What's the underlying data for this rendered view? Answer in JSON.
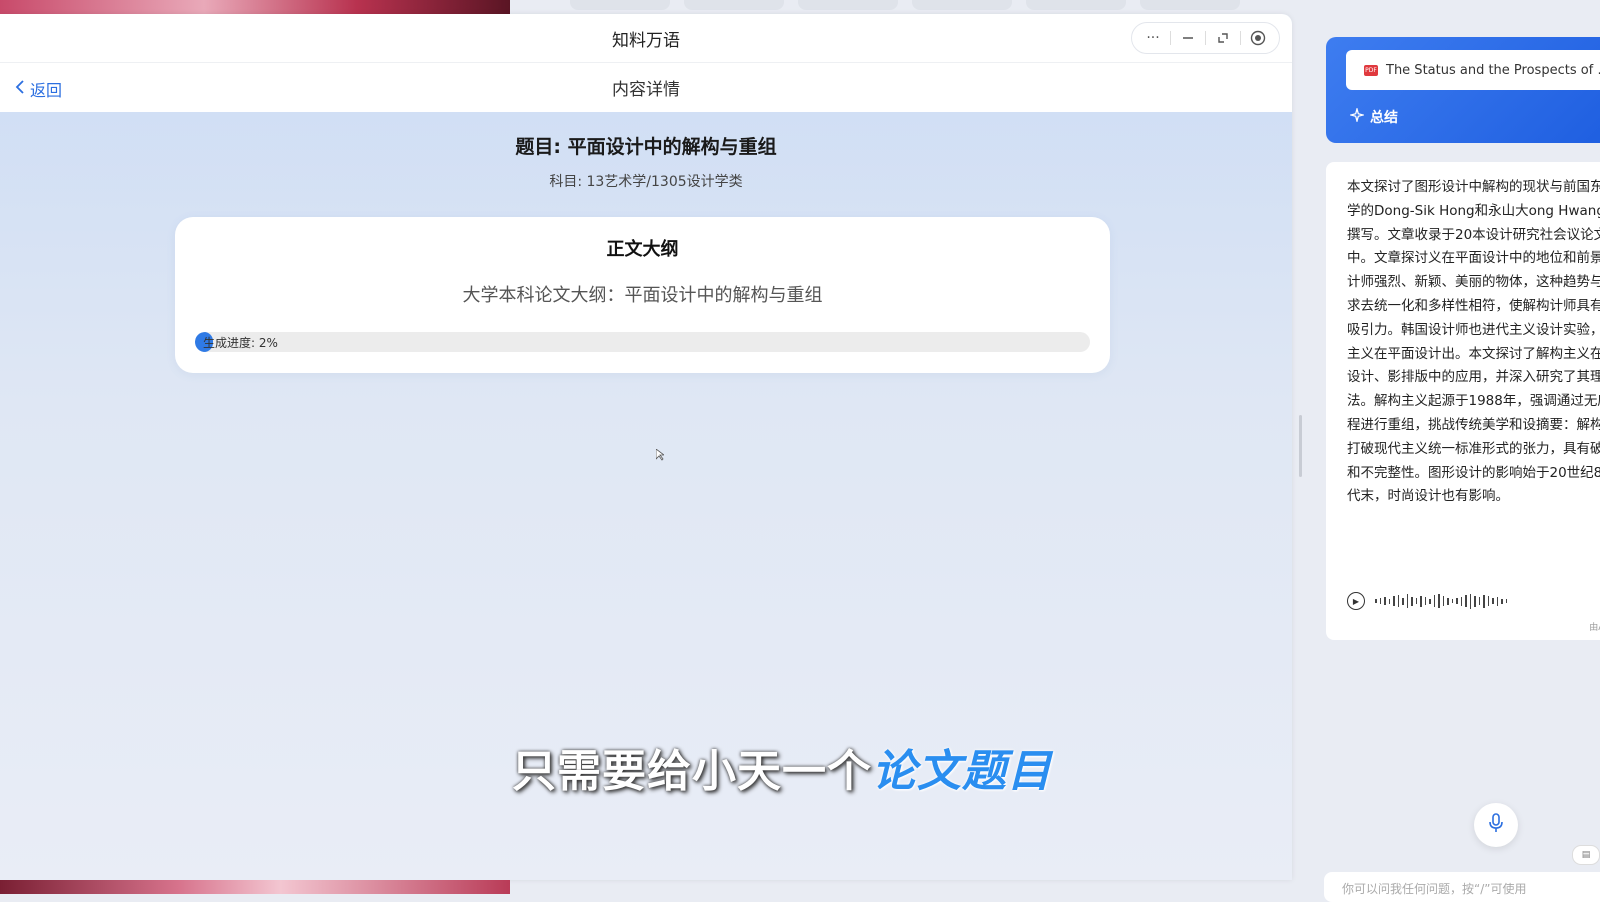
{
  "window": {
    "app_title": "知料万语",
    "nav": {
      "back_label": "返回",
      "page_title": "内容详情"
    }
  },
  "content": {
    "topic": "题目: 平面设计中的解构与重组",
    "subject": "科目: 13艺术学/1305设计学类",
    "outline": {
      "heading": "正文大纲",
      "text": "大学本科论文大纲：平面设计中的解构与重组",
      "progress_label": "生成进度: 2%",
      "progress_percent": 2
    }
  },
  "caption": {
    "part_a": "只需要给小天一个",
    "part_b": "论文题目"
  },
  "right_panel": {
    "doc_name": "The Status and the Prospects of …",
    "summary_label": "总结",
    "summary_text": "本文探讨了图形设计中解构的现状与前国东义大学的Dong-Sik Hong和永山大ong Hwang共同撰写。文章收录于20本设计研究社会议论文集中。文章探讨义在平面设计中的地位和前景。设计师强烈、新颖、美丽的物体，这种趋势与义追求去统一化和多样性相符，使解构计师具有强烈吸引力。韩国设计师也进代主义设计实验，解构主义在平面设计出。本文探讨了解构主义在网站设计、影排版中的应用，并深入研究了其理论法。解构主义起源于1988年，强调通过无序过程进行重组，挑战传统美学和设摘要：解构主义打破现代主义统一标准形式的张力，具有破坏性和不完整性。图形设计的影响始于20世纪80年代末，时尚设计也有影响。",
    "ai_note": "由AI生",
    "input_placeholder": "你可以问我任何问题，按“/”可使用"
  }
}
